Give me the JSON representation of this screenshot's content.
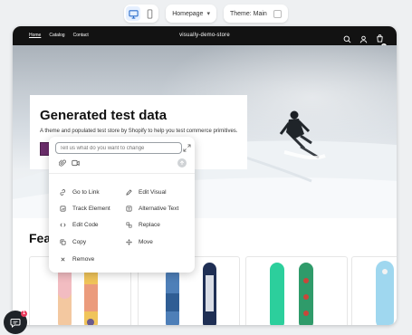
{
  "editor": {
    "page_select": "Homepage",
    "theme_label": "Theme: Main",
    "devices": [
      {
        "icon": "desktop-icon",
        "active": true
      },
      {
        "icon": "mobile-icon",
        "active": false
      }
    ]
  },
  "store": {
    "name": "visually-demo-store",
    "nav": [
      "Home",
      "Catalog",
      "Contact"
    ],
    "cart_count": "1"
  },
  "hero": {
    "title": "Generated test data",
    "subtitle": "A theme and populated test store by Shopify to help you test commerce primitives."
  },
  "featured": {
    "title": "Featured products"
  },
  "ai_menu": {
    "placeholder": "Tell us what do you want to change",
    "actions": [
      {
        "label": "Go to Link",
        "icon": "link-icon"
      },
      {
        "label": "Edit Visual",
        "icon": "pencil-icon"
      },
      {
        "label": "Track Element",
        "icon": "track-icon"
      },
      {
        "label": "Alternative Text",
        "icon": "alt-text-icon"
      },
      {
        "label": "Edit Code",
        "icon": "code-icon"
      },
      {
        "label": "Replace",
        "icon": "replace-icon"
      },
      {
        "label": "Copy",
        "icon": "copy-icon"
      },
      {
        "label": "Move",
        "icon": "move-icon"
      },
      {
        "label": "Remove",
        "icon": "close-icon"
      }
    ]
  },
  "chat": {
    "badge": "1"
  },
  "colors": {
    "header_bg": "#121212",
    "accent": "#2c6ecb",
    "hero_button": "#6b2d6b",
    "badge": "#e8385a"
  }
}
